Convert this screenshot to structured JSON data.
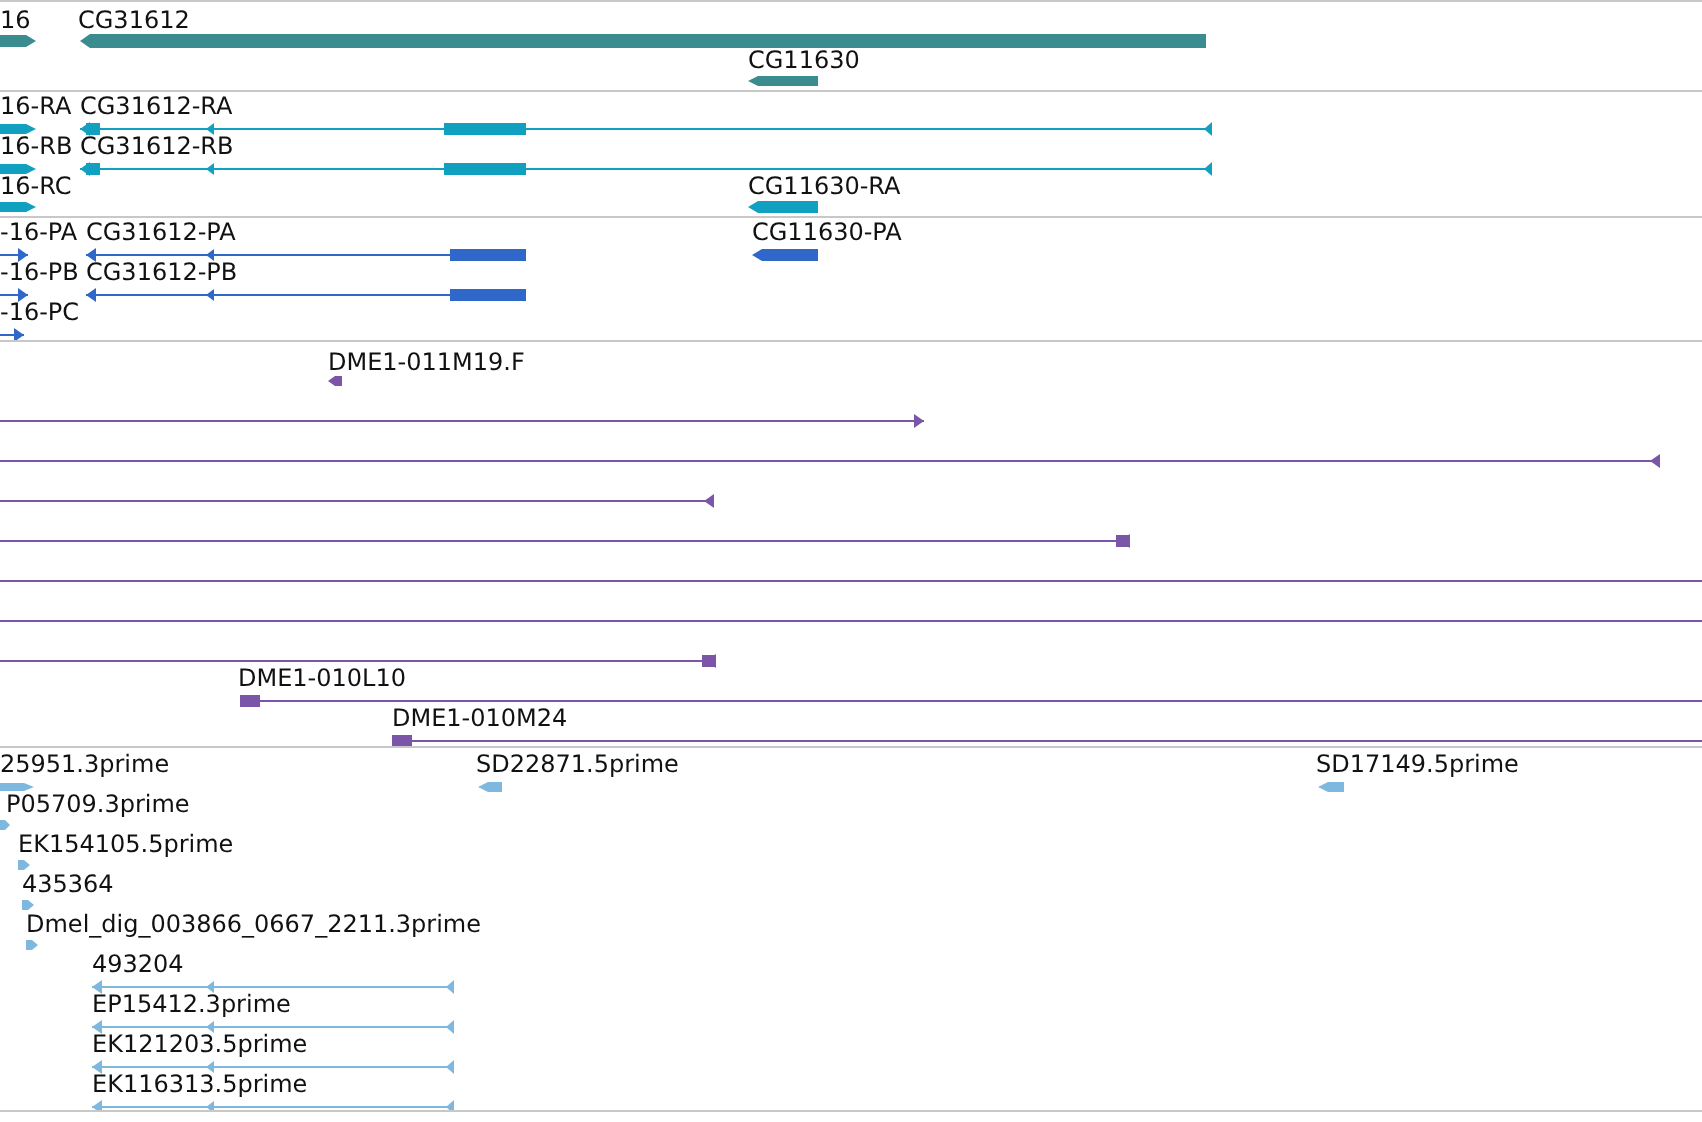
{
  "tracks": [
    {
      "color": "#3b8c8e",
      "features": [
        {
          "label": "16",
          "kind": "forward"
        },
        {
          "label": "CG31612",
          "kind": "reverse"
        },
        {
          "label": "CG11630",
          "kind": "reverse"
        }
      ]
    },
    {
      "color": "#12a0c0",
      "features": [
        {
          "label": "16-RA",
          "kind": "forward"
        },
        {
          "label": "CG31612-RA",
          "kind": "reverse"
        },
        {
          "label": "16-RB",
          "kind": "forward"
        },
        {
          "label": "CG31612-RB",
          "kind": "reverse"
        },
        {
          "label": "16-RC",
          "kind": "forward"
        },
        {
          "label": "CG11630-RA",
          "kind": "reverse"
        }
      ]
    },
    {
      "color": "#2f68c8",
      "features": [
        {
          "label": "-16-PA",
          "kind": "forward"
        },
        {
          "label": "CG31612-PA",
          "kind": "reverse"
        },
        {
          "label": "CG11630-PA",
          "kind": "reverse"
        },
        {
          "label": "-16-PB",
          "kind": "forward"
        },
        {
          "label": "CG31612-PB",
          "kind": "reverse"
        },
        {
          "label": "-16-PC",
          "kind": "forward"
        }
      ]
    },
    {
      "color": "#7a55a8",
      "features": [
        {
          "label": "DME1-011M19.F",
          "kind": "reverse"
        },
        {
          "kind": "forward"
        },
        {
          "kind": "reverse"
        },
        {
          "kind": "reverse"
        },
        {
          "kind": "reverse"
        },
        {
          "kind": "plain"
        },
        {
          "kind": "plain"
        },
        {
          "kind": "reverse"
        },
        {
          "label": "DME1-010L10",
          "kind": "plain"
        },
        {
          "label": "DME1-010M24",
          "kind": "plain"
        }
      ]
    },
    {
      "color": "#7fb8de",
      "features": [
        {
          "label": "25951.3prime",
          "kind": "forward"
        },
        {
          "label": "SD22871.5prime",
          "kind": "reverse"
        },
        {
          "label": "SD17149.5prime",
          "kind": "reverse"
        },
        {
          "label": "P05709.3prime",
          "kind": "forward"
        },
        {
          "label": "EK154105.5prime",
          "kind": "forward"
        },
        {
          "label": "435364",
          "kind": "forward"
        },
        {
          "label": "Dmel_dig_003866_0667_2211.3prime",
          "kind": "forward"
        },
        {
          "label": "493204",
          "kind": "reverse"
        },
        {
          "label": "EP15412.3prime",
          "kind": "reverse"
        },
        {
          "label": "EK121203.5prime",
          "kind": "reverse"
        },
        {
          "label": "EK116313.5prime",
          "kind": "reverse"
        }
      ]
    }
  ]
}
